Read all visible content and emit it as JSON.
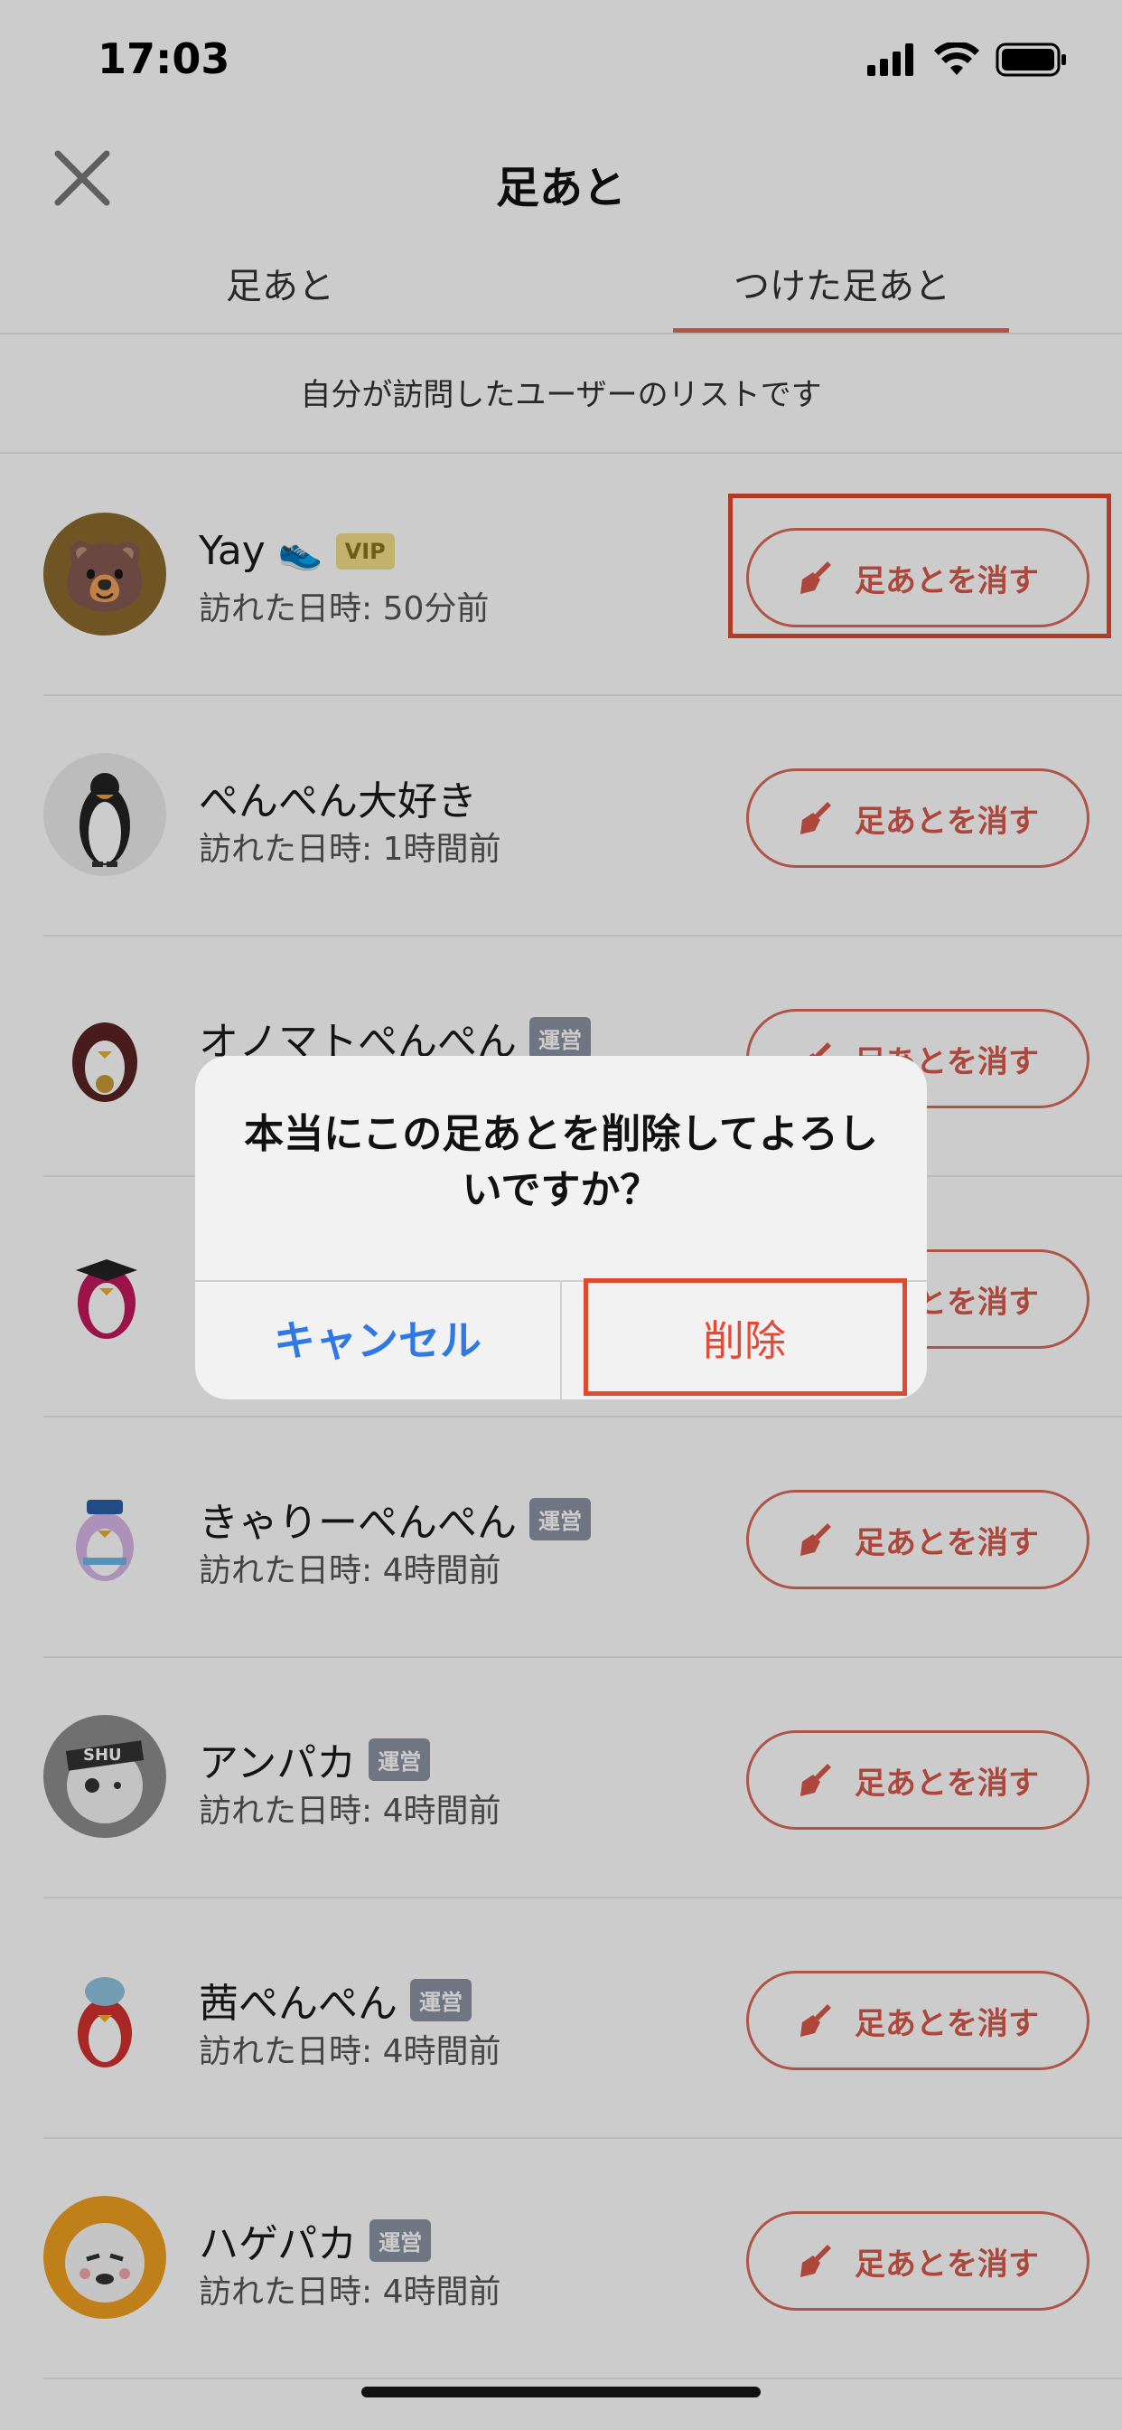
{
  "status_bar": {
    "time": "17:03"
  },
  "header": {
    "title": "足あと"
  },
  "tabs": [
    {
      "label": "足あと"
    },
    {
      "label": "つけた足あと"
    }
  ],
  "subtitle": "自分が訪問したユーザーのリストです",
  "delete_button_label": "足あとを消す",
  "rows": [
    {
      "name": "Yay",
      "shoe": "👟",
      "badge": "VIP",
      "badge_type": "vip",
      "visited": "訪れた日時: 50分前"
    },
    {
      "name": "ぺんぺん大好き",
      "badge": "",
      "badge_type": "",
      "visited": "訪れた日時: 1時間前"
    },
    {
      "name": "オノマトぺんぺん",
      "badge": "運営",
      "badge_type": "staff",
      "visited": ""
    },
    {
      "name": "",
      "badge": "",
      "badge_type": "",
      "visited": ""
    },
    {
      "name": "きゃりーぺんぺん",
      "badge": "運営",
      "badge_type": "staff",
      "visited": "訪れた日時: 4時間前"
    },
    {
      "name": "アンパカ",
      "badge": "運営",
      "badge_type": "staff",
      "visited": "訪れた日時: 4時間前"
    },
    {
      "name": "茜ぺんぺん",
      "badge": "運営",
      "badge_type": "staff",
      "visited": "訪れた日時: 4時間前"
    },
    {
      "name": "ハゲパカ",
      "badge": "運営",
      "badge_type": "staff",
      "visited": "訪れた日時: 4時間前"
    }
  ],
  "avatar_text": {
    "bear": "🐻",
    "shu": "SHU"
  },
  "dialog": {
    "message": "本当にこの足あとを削除してよろしいですか？",
    "cancel_label": "キャンセル",
    "delete_label": "削除"
  },
  "colors": {
    "accent": "#d9594a",
    "cancel_blue": "#2f79e7",
    "highlight_red": "#e04a2f"
  }
}
